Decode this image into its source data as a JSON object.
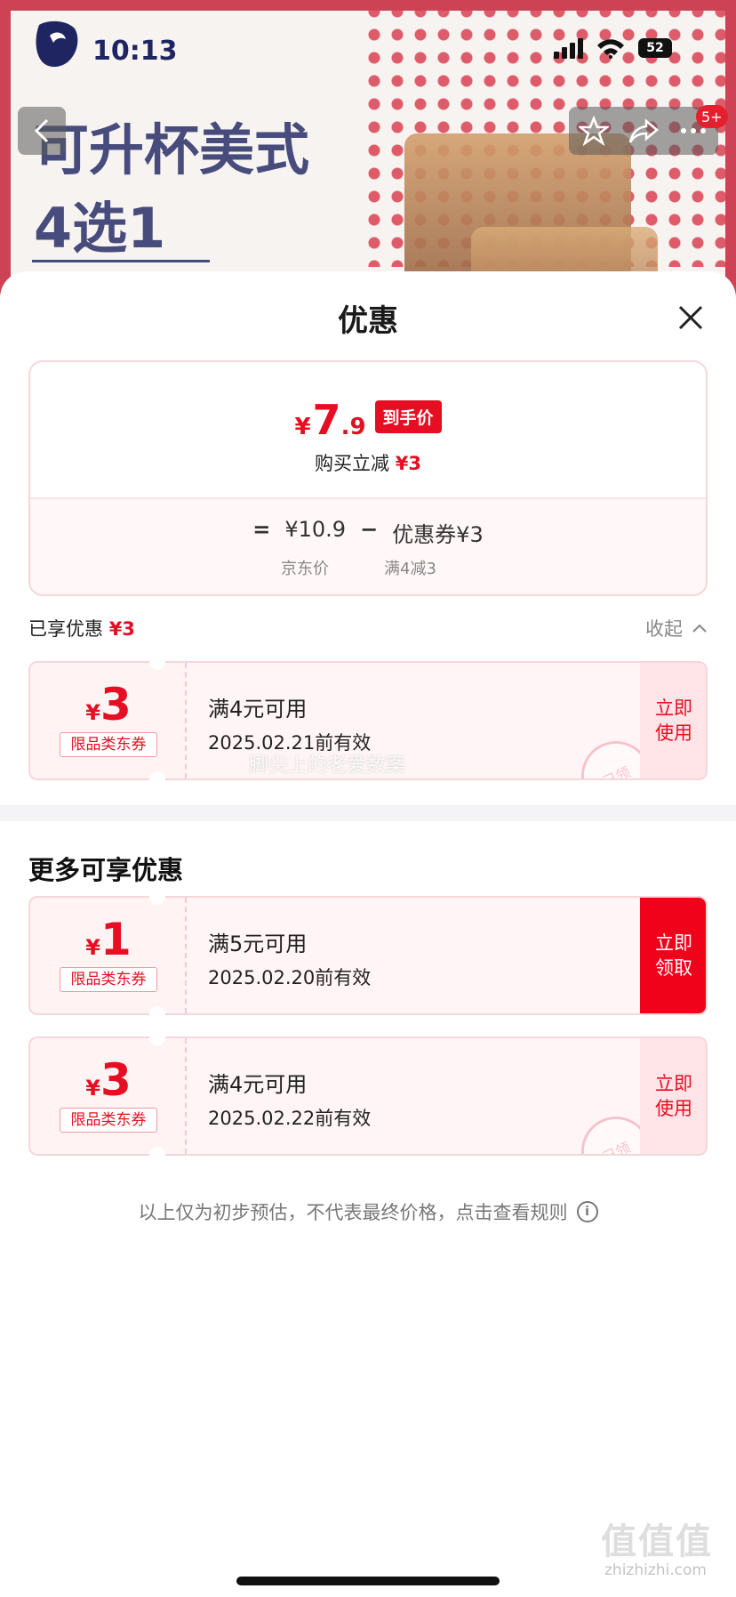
{
  "status_bar": {
    "time": "10:13",
    "battery": "52"
  },
  "banner": {
    "brand": "luckin coffee",
    "headline_line1": "可升杯美式",
    "headline_line2": "4选1",
    "cart_badge": "5+"
  },
  "sheet": {
    "title": "优惠",
    "summary": {
      "currency": "¥",
      "final_int": "7",
      "final_dec": ".9",
      "final_tag": "到手价",
      "instant_label": "购买立减",
      "instant_amount": "¥3",
      "eq": "=",
      "jd_price": "¥10.9",
      "minus": "−",
      "coupon_part": "优惠券¥3",
      "jd_price_label": "京东价",
      "coupon_part_label": "满4减3"
    },
    "enjoyed_label": "已享优惠",
    "enjoyed_amount": "¥3",
    "collapse_label": "收起",
    "used_coupons": [
      {
        "currency": "¥",
        "amount": "3",
        "tag": "限品类东券",
        "condition": "满4元可用",
        "validity": "2025.02.21前有效",
        "action_line1": "立即",
        "action_line2": "使用",
        "stamp": "已领"
      }
    ],
    "overlay_watermark": "脚尖上的老爱数案",
    "more_title": "更多可享优惠",
    "more_coupons": [
      {
        "currency": "¥",
        "amount": "1",
        "tag": "限品类东券",
        "condition": "满5元可用",
        "validity": "2025.02.20前有效",
        "action_line1": "立即",
        "action_line2": "领取"
      },
      {
        "currency": "¥",
        "amount": "3",
        "tag": "限品类东券",
        "condition": "满4元可用",
        "validity": "2025.02.22前有效",
        "action_line1": "立即",
        "action_line2": "使用",
        "stamp": "已领"
      }
    ],
    "disclaimer": "以上仅为初步预估，不代表最终价格，点击查看规则"
  },
  "watermark": {
    "mark": "值值值",
    "url": "zhizhizhi.com"
  },
  "colors": {
    "accent": "#e60e22",
    "brand_blue": "#1f2560",
    "coupon_bg": "#fff5f6"
  }
}
